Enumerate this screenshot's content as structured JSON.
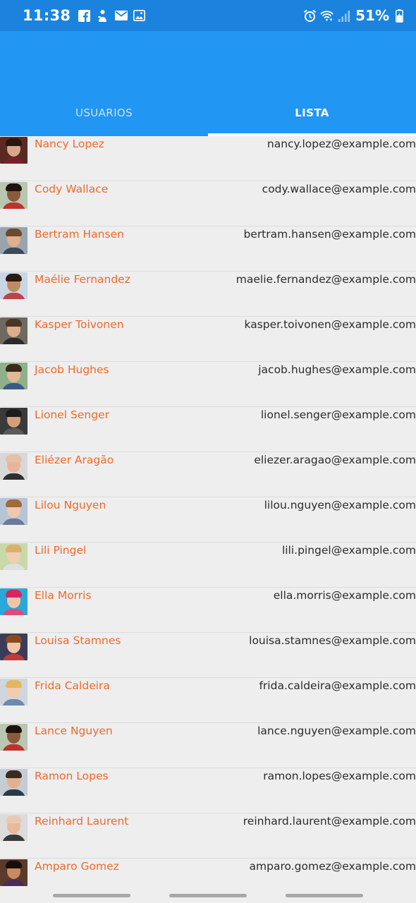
{
  "status_bar": {
    "time": "11:38",
    "battery": "51%",
    "icons_left": [
      "facebook-icon",
      "app-notification-icon",
      "mail-icon",
      "gallery-icon"
    ],
    "icons_right": [
      "alarm-icon",
      "wifi-icon",
      "signal-icon",
      "battery-charging-icon"
    ]
  },
  "tabs": [
    {
      "label": "USUARIOS",
      "active": false
    },
    {
      "label": "LISTA",
      "active": true
    }
  ],
  "colors": {
    "status_bar": "#1b83dd",
    "app_bar": "#2196f3",
    "name_text": "#ee6a2a",
    "email_text": "#2b2b2b",
    "list_background": "#eeeeee"
  },
  "users": [
    {
      "name": "Nancy Lopez",
      "email": "nancy.lopez@example.com"
    },
    {
      "name": "Cody Wallace",
      "email": "cody.wallace@example.com"
    },
    {
      "name": "Bertram Hansen",
      "email": "bertram.hansen@example.com"
    },
    {
      "name": "Maélie Fernandez",
      "email": "maelie.fernandez@example.com"
    },
    {
      "name": "Kasper Toivonen",
      "email": "kasper.toivonen@example.com"
    },
    {
      "name": "Jacob Hughes",
      "email": "jacob.hughes@example.com"
    },
    {
      "name": "Lionel Senger",
      "email": "lionel.senger@example.com"
    },
    {
      "name": "Eliézer Aragão",
      "email": "eliezer.aragao@example.com"
    },
    {
      "name": "Lilou Nguyen",
      "email": "lilou.nguyen@example.com"
    },
    {
      "name": "Lili Pingel",
      "email": "lili.pingel@example.com"
    },
    {
      "name": "Ella Morris",
      "email": "ella.morris@example.com"
    },
    {
      "name": "Louisa Stamnes",
      "email": "louisa.stamnes@example.com"
    },
    {
      "name": "Frida Caldeira",
      "email": "frida.caldeira@example.com"
    },
    {
      "name": "Lance Nguyen",
      "email": "lance.nguyen@example.com"
    },
    {
      "name": "Ramon Lopes",
      "email": "ramon.lopes@example.com"
    },
    {
      "name": "Reinhard Laurent",
      "email": "reinhard.laurent@example.com"
    },
    {
      "name": "Amparo Gomez",
      "email": "amparo.gomez@example.com"
    }
  ]
}
